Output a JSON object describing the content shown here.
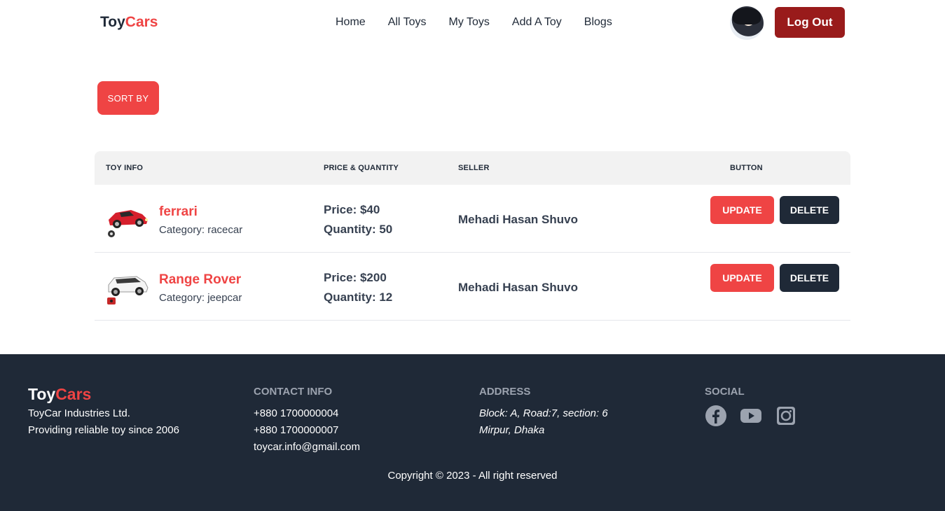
{
  "navbar": {
    "brand_main": "Toy",
    "brand_accent": "Cars",
    "links": [
      "Home",
      "All Toys",
      "My Toys",
      "Add A Toy",
      "Blogs"
    ],
    "logout_label": "Log Out"
  },
  "sort": {
    "label": "SORT BY"
  },
  "table": {
    "headers": {
      "toy_info": "TOY INFO",
      "price_qty": "PRICE & QUANTITY",
      "seller": "SELLER",
      "button": "BUTTON"
    },
    "rows": [
      {
        "name": "ferrari",
        "category": "Category: racecar",
        "price": "Price: $40",
        "quantity": "Quantity: 50",
        "seller": "Mehadi Hasan Shuvo",
        "update_label": "UPDATE",
        "delete_label": "DELETE"
      },
      {
        "name": "Range Rover",
        "category": "Category: jeepcar",
        "price": "Price: $200",
        "quantity": "Quantity: 12",
        "seller": "Mehadi Hasan Shuvo",
        "update_label": "UPDATE",
        "delete_label": "DELETE"
      }
    ]
  },
  "footer": {
    "brand_main": "Toy",
    "brand_accent": "Cars",
    "company": "ToyCar Industries Ltd.",
    "tagline": "Providing reliable toy since 2006",
    "contact_title": "CONTACT INFO",
    "phone1": "+880 1700000004",
    "phone2": "+880 1700000007",
    "email": "toycar.info@gmail.com",
    "address_title": "ADDRESS",
    "address1": "Block: A, Road:7, section: 6",
    "address2": "Mirpur, Dhaka",
    "social_title": "SOCIAL",
    "social_icons": [
      "facebook-icon",
      "youtube-icon",
      "instagram-icon"
    ],
    "copyright": "Copyright © 2023 - All right reserved"
  },
  "colors": {
    "accent": "#ef4444",
    "dark": "#1f2937",
    "logout": "#991b1b"
  }
}
